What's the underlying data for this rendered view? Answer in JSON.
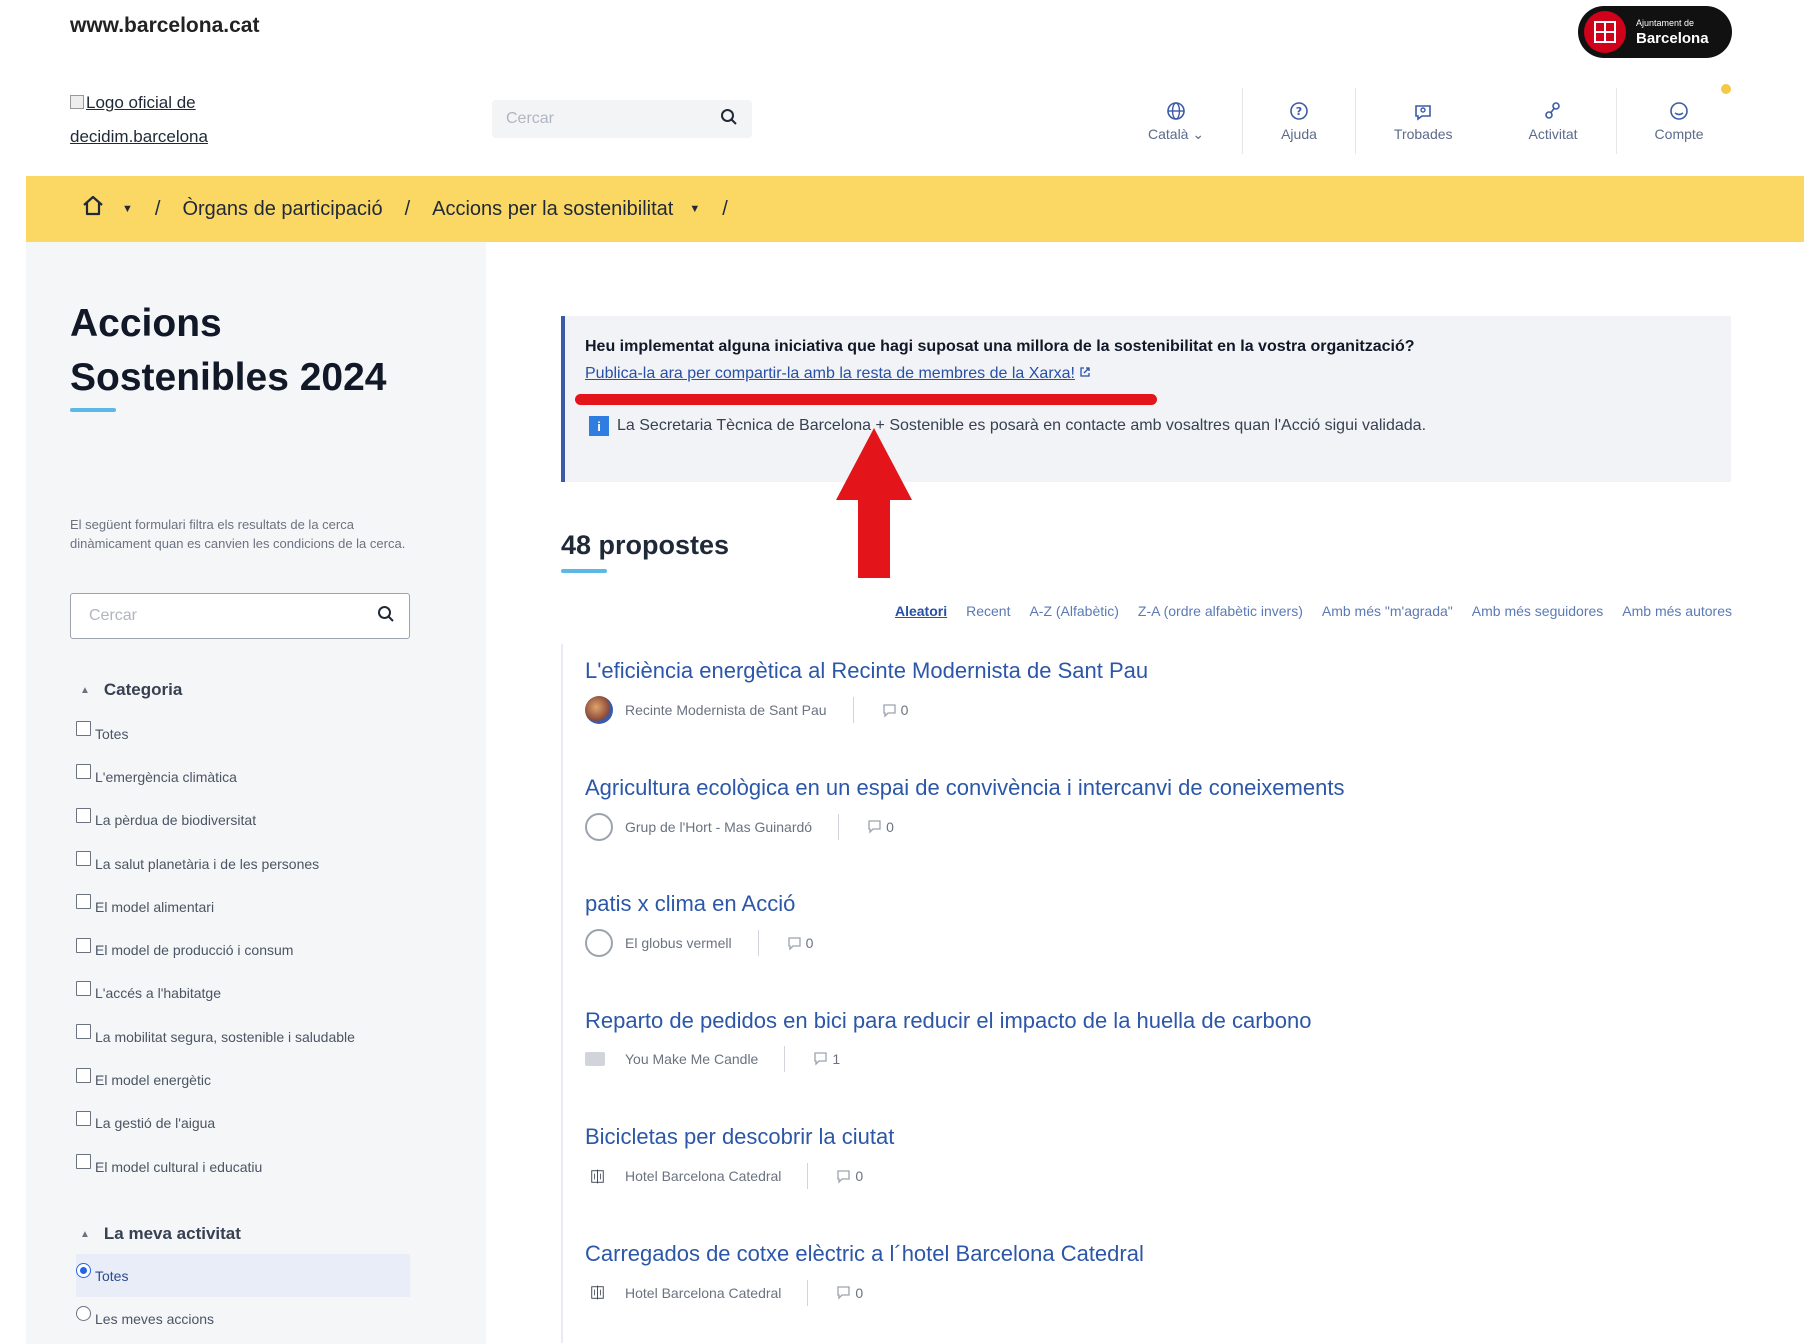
{
  "header": {
    "site_url": "www.barcelona.cat",
    "badge_line1": "Ajuntament de",
    "badge_line2": "Barcelona",
    "logo_alt_line1": "Logo oficial de",
    "logo_alt_line2": "decidim.barcelona",
    "search_placeholder": "Cercar",
    "nav": [
      {
        "label": "Català",
        "icon": "globe-icon"
      },
      {
        "label": "Ajuda",
        "icon": "help-icon"
      },
      {
        "label": "Trobades",
        "icon": "meetings-icon"
      },
      {
        "label": "Activitat",
        "icon": "activity-icon"
      },
      {
        "label": "Compte",
        "icon": "account-icon"
      }
    ]
  },
  "breadcrumb": {
    "items": [
      "Òrgans de participació",
      "Accions per la sostenibilitat"
    ]
  },
  "sidebar": {
    "title": "Accions Sostenibles 2024",
    "filter_help": "El següent formulari filtra els resultats de la cerca dinàmicament quan es canvien les condicions de la cerca.",
    "search_placeholder": "Cercar",
    "category_title": "Categoria",
    "categories": [
      "Totes",
      "L'emergència climàtica",
      "La pèrdua de biodiversitat",
      "La salut planetària i de les persones",
      "El model alimentari",
      "El model de producció i consum",
      "L'accés a l'habitatge",
      "La mobilitat segura, sostenible i saludable",
      "El model energètic",
      "La gestió de l'aigua",
      "El model cultural i educatiu"
    ],
    "activity_title": "La meva activitat",
    "activity": [
      "Totes",
      "Les meves accions"
    ]
  },
  "callout": {
    "question": "Heu implementat alguna iniciativa que hagi suposat una millora de la sostenibilitat en la vostra organització?",
    "link": "Publica-la ara per compartir-la amb la resta de membres de la Xarxa!",
    "info": "La Secretaria Tècnica de Barcelona + Sostenible es posarà en contacte amb vosaltres quan l'Acció sigui validada."
  },
  "main": {
    "count": "48 propostes",
    "sort": [
      "Aleatori",
      "Recent",
      "A-Z (Alfabètic)",
      "Z-A (ordre alfabètic invers)",
      "Amb més \"m'agrada\"",
      "Amb més seguidores",
      "Amb més autores"
    ],
    "proposals": [
      {
        "title": "L'eficiència energètica al Recinte Modernista de Sant Pau",
        "author": "Recinte Modernista de Sant Pau",
        "comments": "0"
      },
      {
        "title": "Agricultura ecològica en un espai de convivència i intercanvi de coneixements",
        "author": "Grup de l'Hort - Mas Guinardó",
        "comments": "0"
      },
      {
        "title": "patis x clima en Acció",
        "author": "El globus vermell",
        "comments": "0"
      },
      {
        "title": "Reparto de pedidos en bici para reducir el impacto de la huella de carbono",
        "author": "You Make Me Candle",
        "comments": "1"
      },
      {
        "title": "Bicicletas per descobrir la ciutat",
        "author": "Hotel Barcelona Catedral",
        "comments": "0"
      },
      {
        "title": "Carregados de cotxe elèctric a l´hotel Barcelona Catedral",
        "author": "Hotel Barcelona Catedral",
        "comments": "0"
      }
    ]
  },
  "colors": {
    "breadcrumb_bg": "#fbd764",
    "link": "#2c57a8",
    "annotation_red": "#e4141b",
    "accent_underline": "#5cb8e6"
  }
}
